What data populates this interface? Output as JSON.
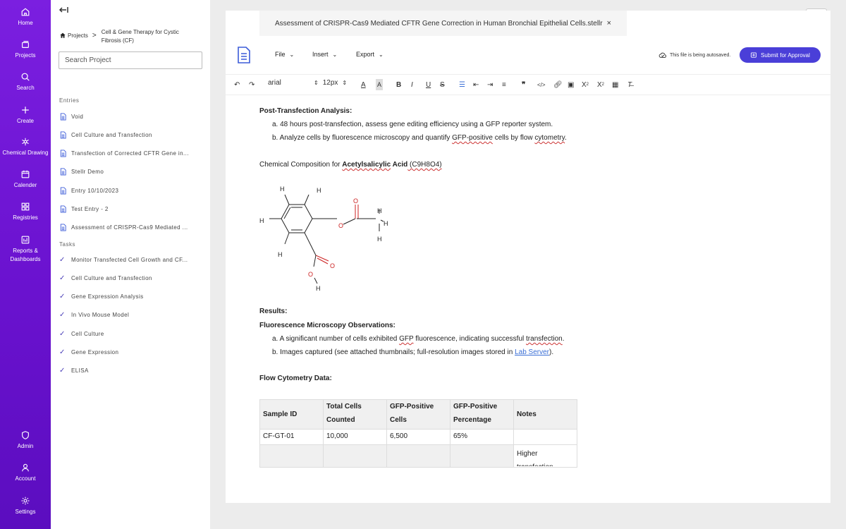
{
  "nav": {
    "items": [
      {
        "key": "home",
        "label": "Home"
      },
      {
        "key": "projects",
        "label": "Projects"
      },
      {
        "key": "search",
        "label": "Search"
      },
      {
        "key": "create",
        "label": "Create"
      },
      {
        "key": "chemical",
        "label": "Chemical Drawing"
      },
      {
        "key": "calender",
        "label": "Calender"
      },
      {
        "key": "registries",
        "label": "Registries"
      },
      {
        "key": "reports",
        "label": "Reports & Dashboards"
      },
      {
        "key": "admin",
        "label": "Admin"
      },
      {
        "key": "account",
        "label": "Account"
      },
      {
        "key": "settings",
        "label": "Settings"
      }
    ]
  },
  "panel": {
    "collapse_icon": "collapse-left-icon",
    "breadcrumb": {
      "projects": "Projects",
      "separator": ">",
      "project": "Cell & Gene Therapy for Cystic Fibrosis (CF)"
    },
    "search_placeholder": "Search Project",
    "entries_heading": "Entries",
    "entries": [
      "Void",
      "Cell Culture and Transfection",
      "Transfection of Corrected CFTR Gene in...",
      "Stellr Demo",
      "Entry 10/10/2023",
      "Test Entry - 2",
      "Assessment of CRISPR-Cas9 Mediated ..."
    ],
    "tasks_heading": "Tasks",
    "tasks": [
      "Monitor Transfected Cell Growth and CF...",
      "Cell Culture and Transfection",
      "Gene Expression Analysis",
      "In Vivo Mouse Model",
      "Cell Culture",
      "Gene Expression",
      "ELISA"
    ]
  },
  "doc": {
    "tab_title": "Assessment of CRISPR-Cas9 Mediated CFTR Gene Correction in Human Bronchial Epithelial Cells.stellr",
    "tab_close": "×",
    "menus": {
      "file": "File",
      "insert": "Insert",
      "export": "Export"
    },
    "autosave": "This file is being autosaved.",
    "submit": "Submit for Approval",
    "toolbar": {
      "font": "arial",
      "size": "12px"
    },
    "body": {
      "post_heading": "Post-Transfection Analysis:",
      "post_a": "a. 48 hours post-transfection, assess gene editing efficiency using a GFP reporter system.",
      "post_b_1": "b. Analyze cells by fluorescence microscopy and quantify ",
      "post_b_gfp": "GFP-positive",
      "post_b_2": " cells by flow ",
      "post_b_cyto": "cytometry",
      "post_b_end": ".",
      "chem_1": "Chemical Composition for ",
      "chem_name": "Acetylsalicylic",
      "chem_name2": " Acid",
      "chem_formula": " (C9H8O4)",
      "results": "Results:",
      "fluor_heading": "Fluorescence Microscopy Observations:",
      "fluor_a_1": "a. A significant number of cells exhibited ",
      "fluor_a_gfp": "GFP",
      "fluor_a_2": " fluorescence, indicating successful ",
      "fluor_a_trans": "transfection",
      "fluor_a_end": ".",
      "fluor_b_1": "b. Images captured (see attached thumbnails; full-resolution images stored in ",
      "fluor_b_link": "Lab Server",
      "fluor_b_end": ").",
      "flow_heading": "Flow Cytometry Data:"
    },
    "molecule_atoms": {
      "h": "H",
      "o": "O"
    },
    "table": {
      "headers": [
        "Sample ID",
        "Total Cells Counted",
        "GFP-Positive Cells",
        "GFP-Positive Percentage",
        "Notes"
      ],
      "rows": [
        [
          "CF-GT-01",
          "10,000",
          "6,500",
          "65%",
          ""
        ],
        [
          "",
          "",
          "",
          "",
          "Higher transfection"
        ]
      ]
    }
  },
  "colors": {
    "rail": "#6a12cf",
    "accent": "#4a3fd8",
    "check": "#4a3fb8"
  }
}
